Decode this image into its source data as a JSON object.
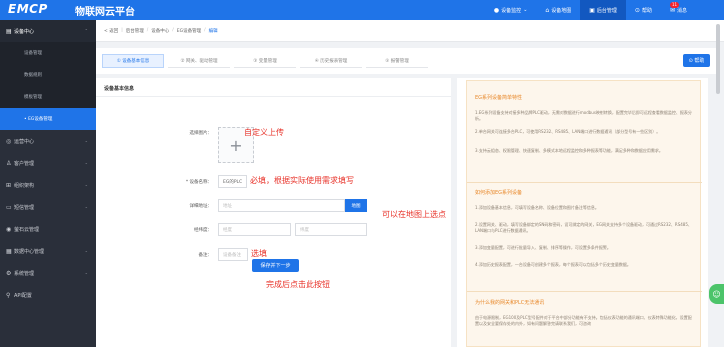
{
  "topbar": {
    "logo": "EMCP",
    "brand": "物联网云平台",
    "nav": [
      {
        "label": "设备监控",
        "icon": "monitor-icon",
        "caret": "⌄"
      },
      {
        "label": "设备地图",
        "icon": "map-icon"
      },
      {
        "label": "后台管理",
        "icon": "admin-icon",
        "active": true
      },
      {
        "label": "帮助",
        "icon": "help-icon"
      },
      {
        "label": "消息",
        "icon": "message-icon",
        "badge": "11"
      }
    ]
  },
  "sidebar": {
    "groups": [
      {
        "label": "设备中心",
        "icon": "device-icon",
        "open": true,
        "items": [
          {
            "label": "设备管理"
          },
          {
            "label": "数据规则"
          },
          {
            "label": "模板管理"
          },
          {
            "label": "• EG设备管理",
            "active": true
          }
        ]
      },
      {
        "label": "运营中心",
        "icon": "ops-icon"
      },
      {
        "label": "客户管理",
        "icon": "customer-icon"
      },
      {
        "label": "组织架构",
        "icon": "org-icon"
      },
      {
        "label": "短信管理",
        "icon": "sms-icon"
      },
      {
        "label": "萤石云管理",
        "icon": "cloud-icon"
      },
      {
        "label": "数据中心管理",
        "icon": "data-icon"
      },
      {
        "label": "系统管理",
        "icon": "system-icon"
      },
      {
        "label": "API配置",
        "icon": "api-icon"
      }
    ]
  },
  "breadcrumb": {
    "back": "< 返回",
    "items": [
      "后台管理",
      "设备中心",
      "EG设备管理",
      "编辑"
    ]
  },
  "steps": [
    {
      "label": "① 设备基本信息",
      "active": true
    },
    {
      "label": "② 网关、驱动管理"
    },
    {
      "label": "③ 变量管理"
    },
    {
      "label": "④ 历史报表管理"
    },
    {
      "label": "⑤ 报警管理"
    }
  ],
  "help_button": "⊙ 帮助",
  "form": {
    "section_title": "设备基本信息",
    "image_label": "选择图片：",
    "name_label": "* 设备名称：",
    "name_value": "EG的PLC",
    "address_label": "详细地址：",
    "address_placeholder": "地址",
    "map_button": "地图",
    "coords_label": "经纬度：",
    "lng_placeholder": "经度",
    "lat_placeholder": "纬度",
    "remark_label": "备注：",
    "remark_placeholder": "设备备注",
    "save_button": "保存并下一步"
  },
  "annotations": {
    "image": "自定义上传",
    "name": "必填，根据实际使用需求填写",
    "map": "可以在地图上选点",
    "remark": "选填",
    "save": "完成后点击此按钮"
  },
  "info": {
    "title1": "EG系列设备简单特性",
    "p1": "1.EG系列设备支持对接多种品牌PLC驱动，无需对数据进行modbus映射转换，配置完毕后即可远程查看数据监控、报表分析。",
    "p2": "2.单台网关可连接多台PLC，可使用RS232、RS485、LAN端口进行数据通讯（部分型号有一些区别）。",
    "p3": "3.支持云组态、权限管理、快速复制、多模式本地远程监控和多种报表等功能，满足多种和数据应用需求。",
    "title2": "如何添加EG系列设备",
    "p4": "1.添加设备基本信息，可填写设备名称、设备位置和图片备注等信息。",
    "p5": "2.设置网关、驱动，填写设备绑定的SN码和密码，设可绑定的网关，EG网关支持多个设备驱动，可通过RS232、RS485、LAN端口与PLC进行数据通讯。",
    "p6": "3.添加变量配置，可进行批量导入、复制、排序等操作，可设置多条件报警。",
    "p7": "4.添加历史报表配置，一台设备可创建多个报表，每个报表可以包括多个历史变量数据。",
    "title3": "为什么我的网关和PLC无法通讯",
    "p8": "由于电源限制，EG100及PLC型号配件对于平台中部分功能有不支持。包括仪表功能的通讯端口、仪表特殊功能化，设置配置以及安全要保存处的内外，如有问题解答完请联系我们，可咨询"
  }
}
